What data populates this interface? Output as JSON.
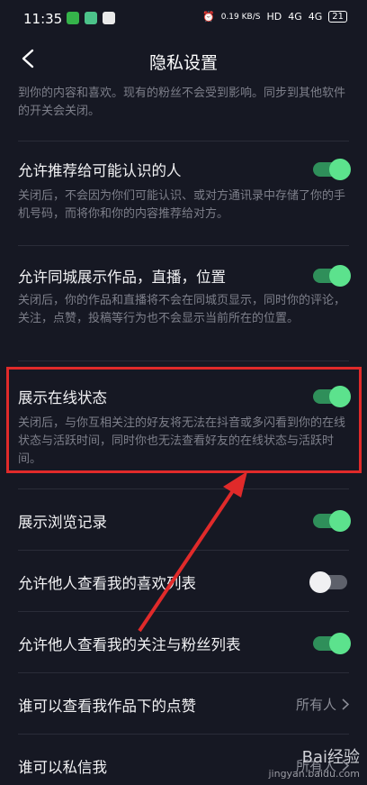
{
  "status_bar": {
    "time": "11:35",
    "network_speed": "0.19 KB/S",
    "hd": "HD",
    "signal_1": "4G",
    "signal_2": "4G",
    "battery": "21"
  },
  "header": {
    "title": "隐私设置"
  },
  "intro_text": "到你的内容和喜欢。现有的粉丝不会受到影响。同步到其他软件的开关会关闭。",
  "settings": [
    {
      "title": "允许推荐给可能认识的人",
      "description": "关闭后，不会因为你们可能认识、或对方通讯录中存储了你的手机号码，而将你和你的内容推荐给对方。",
      "toggle_on": true
    },
    {
      "title": "允许同城展示作品，直播，位置",
      "description": "关闭后，你的作品和直播将不会在同城页显示，同时你的评论，关注，点赞，投稿等行为也不会显示当前所在的位置。",
      "toggle_on": true
    },
    {
      "title": "展示在线状态",
      "description": "关闭后，与你互相关注的好友将无法在抖音或多闪看到你的在线状态与活跃时间，同时你也无法查看好友的在线状态与活跃时间。",
      "toggle_on": true
    },
    {
      "title": "展示浏览记录",
      "toggle_on": true
    },
    {
      "title": "允许他人查看我的喜欢列表",
      "toggle_on": false
    },
    {
      "title": "允许他人查看我的关注与粉丝列表",
      "toggle_on": true
    },
    {
      "title": "谁可以查看我作品下的点赞",
      "value": "所有人"
    },
    {
      "title": "谁可以私信我",
      "value": "所有人"
    }
  ],
  "watermark": {
    "brand": "Bai经验",
    "url": "jingyan.baidu.com"
  },
  "colors": {
    "background": "#161823",
    "toggle_on": "#5ce28d",
    "highlight": "#e02a2a"
  }
}
